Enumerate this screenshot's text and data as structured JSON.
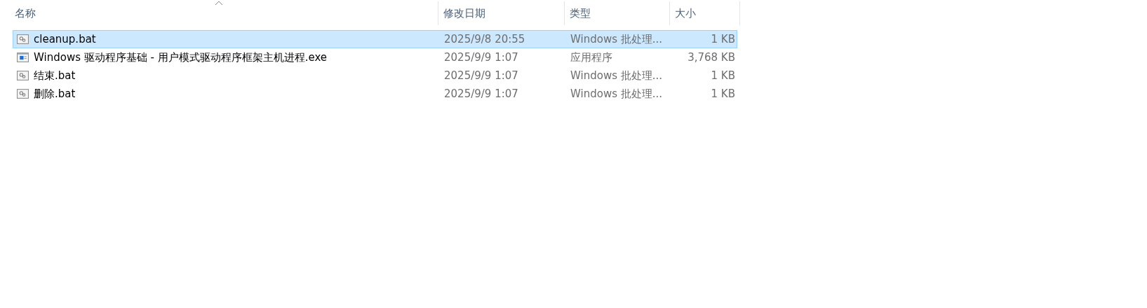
{
  "table": {
    "columns": [
      {
        "label": "名称",
        "sorted": true
      },
      {
        "label": "修改日期",
        "sorted": false
      },
      {
        "label": "类型",
        "sorted": false
      },
      {
        "label": "大小",
        "sorted": false
      }
    ],
    "rows": [
      {
        "kind": "bat",
        "name": "cleanup.bat",
        "modified": "2025/9/8 20:55",
        "type": "Windows 批处理...",
        "size": "1 KB",
        "selected": true
      },
      {
        "kind": "exe",
        "name": "Windows 驱动程序基础 - 用户模式驱动程序框架主机进程.exe",
        "modified": "2025/9/9 1:07",
        "type": "应用程序",
        "size": "3,768 KB",
        "selected": false
      },
      {
        "kind": "bat",
        "name": "结束.bat",
        "modified": "2025/9/9 1:07",
        "type": "Windows 批处理...",
        "size": "1 KB",
        "selected": false
      },
      {
        "kind": "bat",
        "name": "删除.bat",
        "modified": "2025/9/9 1:07",
        "type": "Windows 批处理...",
        "size": "1 KB",
        "selected": false
      }
    ]
  }
}
